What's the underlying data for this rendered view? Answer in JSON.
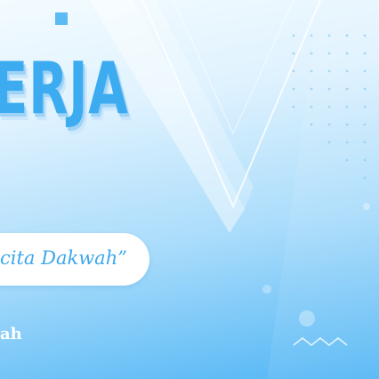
{
  "banner": {
    "title": "ERJA",
    "theme": "cita Dakwah”",
    "footer": "ah"
  },
  "colors": {
    "accent": "#3cabf0",
    "bg_top": "#f3fbff",
    "bg_bottom": "#52b6f5",
    "pill": "#ffffff"
  }
}
